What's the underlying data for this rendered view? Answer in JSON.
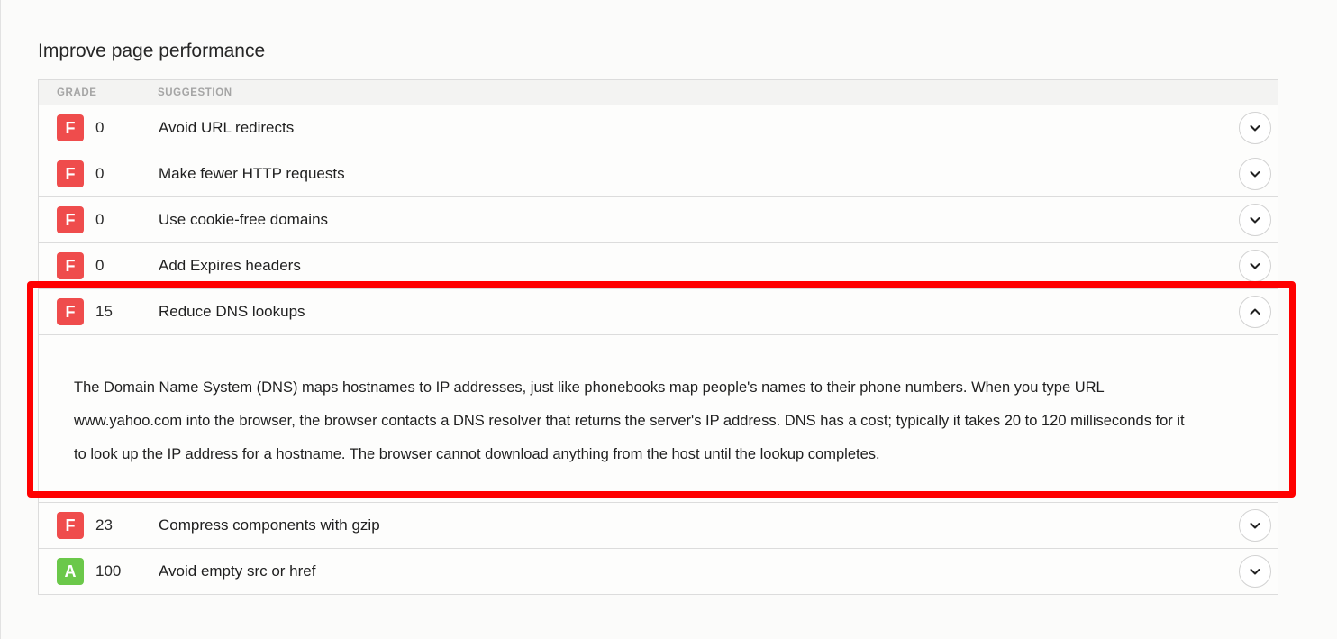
{
  "section": {
    "title": "Improve page performance"
  },
  "table": {
    "headers": {
      "grade": "GRADE",
      "suggestion": "SUGGESTION"
    },
    "rows": [
      {
        "grade": "F",
        "score": "0",
        "suggestion": "Avoid URL redirects",
        "expanded": false
      },
      {
        "grade": "F",
        "score": "0",
        "suggestion": "Make fewer HTTP requests",
        "expanded": false
      },
      {
        "grade": "F",
        "score": "0",
        "suggestion": "Use cookie-free domains",
        "expanded": false
      },
      {
        "grade": "F",
        "score": "0",
        "suggestion": "Add Expires headers",
        "expanded": false
      },
      {
        "grade": "F",
        "score": "15",
        "suggestion": "Reduce DNS lookups",
        "expanded": true,
        "detail": "The Domain Name System (DNS) maps hostnames to IP addresses, just like phonebooks map people's names to their phone numbers. When you type URL www.yahoo.com into the browser, the browser contacts a DNS resolver that returns the server's IP address. DNS has a cost; typically it takes 20 to 120 milliseconds for it to look up the IP address for a hostname. The browser cannot download anything from the host until the lookup completes."
      },
      {
        "grade": "F",
        "score": "23",
        "suggestion": "Compress components with gzip",
        "expanded": false
      },
      {
        "grade": "A",
        "score": "100",
        "suggestion": "Avoid empty src or href",
        "expanded": false
      }
    ]
  },
  "colors": {
    "grade_f": "#ef4c4c",
    "grade_a": "#6bc84a",
    "highlight": "#ff0000"
  },
  "icons": {
    "collapsed": "chevron-down-icon",
    "expanded": "chevron-up-icon"
  }
}
